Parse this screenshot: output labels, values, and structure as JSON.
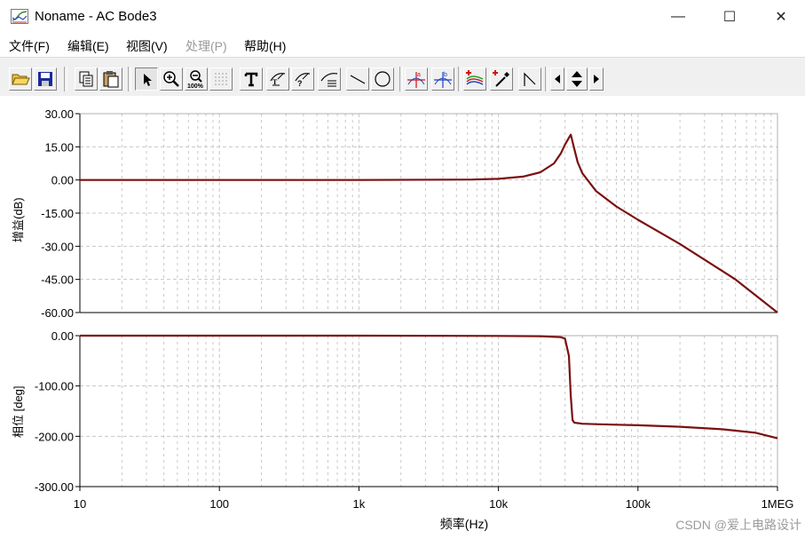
{
  "window": {
    "title": "Noname - AC Bode3",
    "minimize": "—",
    "maximize": "☐",
    "close": "✕"
  },
  "menu": [
    {
      "label": "文件(F)",
      "enabled": true
    },
    {
      "label": "编辑(E)",
      "enabled": true
    },
    {
      "label": "视图(V)",
      "enabled": true
    },
    {
      "label": "处理(P)",
      "enabled": false
    },
    {
      "label": "帮助(H)",
      "enabled": true
    }
  ],
  "toolbar": {
    "buttons": [
      {
        "icon": "open-folder-icon"
      },
      {
        "icon": "save-icon"
      },
      {
        "icon": "copy-icon"
      },
      {
        "icon": "paste-icon"
      },
      {
        "icon": "select-arrow-icon",
        "pressed": true
      },
      {
        "icon": "zoom-in-icon"
      },
      {
        "icon": "zoom-100-icon"
      },
      {
        "icon": "grid-icon"
      },
      {
        "icon": "text-icon"
      },
      {
        "icon": "label-curve-icon"
      },
      {
        "icon": "label-question-icon"
      },
      {
        "icon": "label-box-icon"
      },
      {
        "icon": "line-icon"
      },
      {
        "icon": "ellipse-icon"
      },
      {
        "icon": "cursor-a-icon"
      },
      {
        "icon": "cursor-b-icon"
      },
      {
        "icon": "add-curves-icon"
      },
      {
        "icon": "probe-icon"
      },
      {
        "icon": "polyline-icon"
      },
      {
        "icon": "scroll-left-icon"
      },
      {
        "icon": "scroll-updown-icon"
      },
      {
        "icon": "scroll-right-icon"
      }
    ]
  },
  "colors": {
    "curve": "#7b1010",
    "grid": "#c8c8c8",
    "axis": "#000000"
  },
  "chart_data": [
    {
      "type": "line",
      "ylabel": "增益(dB)",
      "xscale": "log",
      "xlim": [
        10,
        1000000
      ],
      "ylim": [
        -60,
        30
      ],
      "yticks": [
        "30.00",
        "15.00",
        "0.00",
        "-15.00",
        "-30.00",
        "-45.00",
        "-60.00"
      ],
      "grid": true,
      "series": [
        {
          "x": [
            10,
            100,
            1000,
            6500,
            10000,
            15000,
            20000,
            25000,
            28000,
            30000,
            33000,
            35000,
            37000,
            40000,
            50000,
            70000,
            100000,
            200000,
            500000,
            1000000
          ],
          "y": [
            0,
            0,
            0,
            0.2,
            0.5,
            1.5,
            3.5,
            7.5,
            12,
            16,
            20.5,
            14,
            8,
            3,
            -5,
            -12,
            -18,
            -29,
            -45,
            -60
          ]
        }
      ]
    },
    {
      "type": "line",
      "ylabel": "相位 [deg]",
      "xlabel": "频率(Hz)",
      "xscale": "log",
      "xlim": [
        10,
        1000000
      ],
      "ylim": [
        -300,
        0
      ],
      "yticks": [
        "0.00",
        "-100.00",
        "-200.00",
        "-300.00"
      ],
      "xticks": [
        "10",
        "100",
        "1k",
        "10k",
        "100k",
        "1MEG"
      ],
      "grid": true,
      "series": [
        {
          "x": [
            10,
            100,
            1000,
            10000,
            20000,
            28000,
            30000,
            32000,
            33000,
            34000,
            35000,
            40000,
            50000,
            70000,
            100000,
            200000,
            400000,
            700000,
            1000000
          ],
          "y": [
            0,
            0,
            0,
            -0.5,
            -1,
            -3,
            -6,
            -40,
            -120,
            -168,
            -173,
            -175,
            -176,
            -177,
            -178,
            -181,
            -186,
            -193,
            -204
          ]
        }
      ]
    }
  ],
  "watermark": "CSDN @爱上电路设计"
}
